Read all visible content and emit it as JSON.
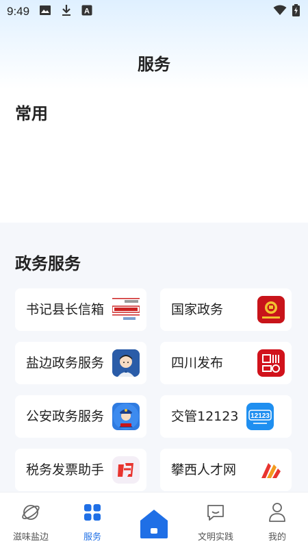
{
  "status_bar": {
    "time": "9:49"
  },
  "page": {
    "title": "服务"
  },
  "common": {
    "title": "常用"
  },
  "gov": {
    "title": "政务服务",
    "items": [
      {
        "label": "书记县长信箱",
        "icon": "mailbox-icon"
      },
      {
        "label": "国家政务",
        "icon": "national-emblem-icon"
      },
      {
        "label": "盐边政务服务",
        "icon": "officer-avatar-icon"
      },
      {
        "label": "四川发布",
        "icon": "sichuan-publish-icon"
      },
      {
        "label": "公安政务服务",
        "icon": "police-icon"
      },
      {
        "label": "交管12123",
        "icon": "traffic-12123-icon"
      },
      {
        "label": "税务发票助手",
        "icon": "tax-helper-icon"
      },
      {
        "label": "攀西人才网",
        "icon": "talent-network-icon"
      }
    ]
  },
  "tabbar": {
    "items": [
      {
        "label": "滋味盐边",
        "icon": "planet-icon"
      },
      {
        "label": "服务",
        "icon": "grid-icon"
      },
      {
        "label": "",
        "icon": "home-icon"
      },
      {
        "label": "文明实践",
        "icon": "chat-icon"
      },
      {
        "label": "我的",
        "icon": "person-icon"
      }
    ]
  },
  "colors": {
    "accent": "#1f6fe6",
    "background": "#f5f7fb"
  }
}
